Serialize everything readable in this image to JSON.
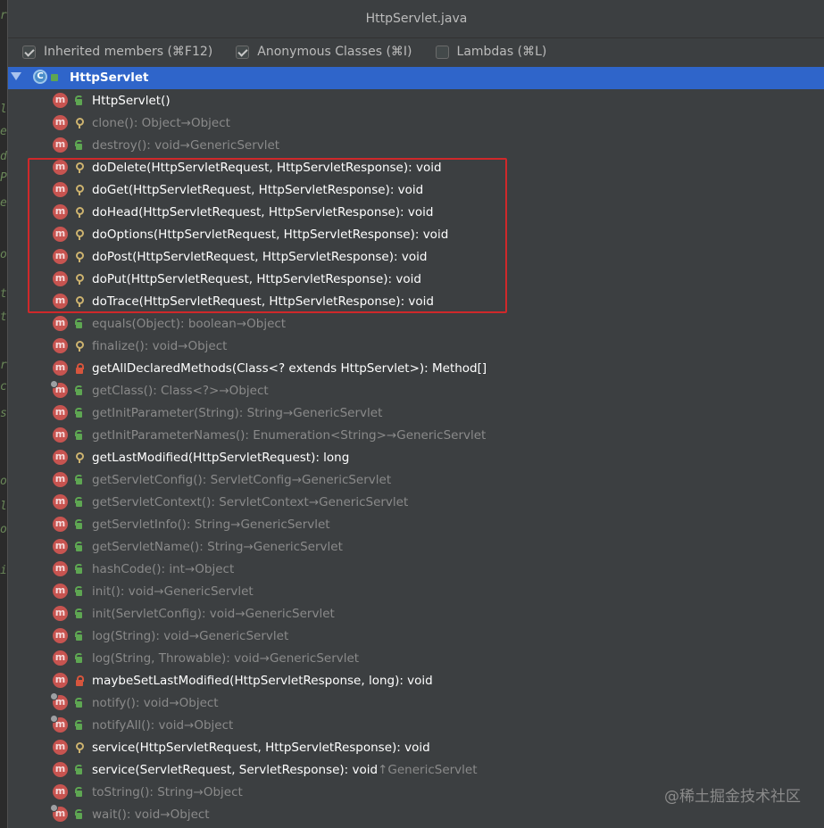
{
  "window": {
    "title": "HttpServlet.java"
  },
  "options": [
    {
      "label": "Inherited members (⌘F12)",
      "checked": true
    },
    {
      "label": "Anonymous Classes (⌘I)",
      "checked": true
    },
    {
      "label": "Lambdas (⌘L)",
      "checked": false
    }
  ],
  "root": {
    "label": "HttpServlet"
  },
  "members": [
    {
      "sig": "HttpServlet()",
      "suffix": "",
      "vis": "public",
      "inherited": false
    },
    {
      "sig": "clone(): Object",
      "suffix": " →Object",
      "vis": "protected",
      "inherited": true
    },
    {
      "sig": "destroy(): void",
      "suffix": " →GenericServlet",
      "vis": "public",
      "inherited": true
    },
    {
      "sig": "doDelete(HttpServletRequest, HttpServletResponse): void",
      "suffix": "",
      "vis": "protected",
      "inherited": false
    },
    {
      "sig": "doGet(HttpServletRequest, HttpServletResponse): void",
      "suffix": "",
      "vis": "protected",
      "inherited": false
    },
    {
      "sig": "doHead(HttpServletRequest, HttpServletResponse): void",
      "suffix": "",
      "vis": "protected",
      "inherited": false
    },
    {
      "sig": "doOptions(HttpServletRequest, HttpServletResponse): void",
      "suffix": "",
      "vis": "protected",
      "inherited": false
    },
    {
      "sig": "doPost(HttpServletRequest, HttpServletResponse): void",
      "suffix": "",
      "vis": "protected",
      "inherited": false
    },
    {
      "sig": "doPut(HttpServletRequest, HttpServletResponse): void",
      "suffix": "",
      "vis": "protected",
      "inherited": false
    },
    {
      "sig": "doTrace(HttpServletRequest, HttpServletResponse): void",
      "suffix": "",
      "vis": "protected",
      "inherited": false
    },
    {
      "sig": "equals(Object): boolean",
      "suffix": " →Object",
      "vis": "public",
      "inherited": true
    },
    {
      "sig": "finalize(): void",
      "suffix": " →Object",
      "vis": "protected",
      "inherited": true
    },
    {
      "sig": "getAllDeclaredMethods(Class<? extends HttpServlet>): Method[]",
      "suffix": "",
      "vis": "private",
      "inherited": false
    },
    {
      "sig": "getClass(): Class<?>",
      "suffix": " →Object",
      "vis": "public",
      "inherited": true,
      "override": true
    },
    {
      "sig": "getInitParameter(String): String",
      "suffix": " →GenericServlet",
      "vis": "public",
      "inherited": true
    },
    {
      "sig": "getInitParameterNames(): Enumeration<String>",
      "suffix": " →GenericServlet",
      "vis": "public",
      "inherited": true
    },
    {
      "sig": "getLastModified(HttpServletRequest): long",
      "suffix": "",
      "vis": "protected",
      "inherited": false
    },
    {
      "sig": "getServletConfig(): ServletConfig",
      "suffix": " →GenericServlet",
      "vis": "public",
      "inherited": true
    },
    {
      "sig": "getServletContext(): ServletContext",
      "suffix": " →GenericServlet",
      "vis": "public",
      "inherited": true
    },
    {
      "sig": "getServletInfo(): String",
      "suffix": " →GenericServlet",
      "vis": "public",
      "inherited": true
    },
    {
      "sig": "getServletName(): String",
      "suffix": " →GenericServlet",
      "vis": "public",
      "inherited": true
    },
    {
      "sig": "hashCode(): int",
      "suffix": " →Object",
      "vis": "public",
      "inherited": true
    },
    {
      "sig": "init(): void",
      "suffix": " →GenericServlet",
      "vis": "public",
      "inherited": true
    },
    {
      "sig": "init(ServletConfig): void",
      "suffix": " →GenericServlet",
      "vis": "public",
      "inherited": true
    },
    {
      "sig": "log(String): void",
      "suffix": " →GenericServlet",
      "vis": "public",
      "inherited": true
    },
    {
      "sig": "log(String, Throwable): void",
      "suffix": " →GenericServlet",
      "vis": "public",
      "inherited": true
    },
    {
      "sig": "maybeSetLastModified(HttpServletResponse, long): void",
      "suffix": "",
      "vis": "private",
      "inherited": false
    },
    {
      "sig": "notify(): void",
      "suffix": " →Object",
      "vis": "public",
      "inherited": true,
      "override": true
    },
    {
      "sig": "notifyAll(): void",
      "suffix": " →Object",
      "vis": "public",
      "inherited": true,
      "override": true
    },
    {
      "sig": "service(HttpServletRequest, HttpServletResponse): void",
      "suffix": "",
      "vis": "protected",
      "inherited": false
    },
    {
      "sig": "service(ServletRequest, ServletResponse): void",
      "suffix": " ↑GenericServlet",
      "vis": "public",
      "inherited": false
    },
    {
      "sig": "toString(): String",
      "suffix": " →Object",
      "vis": "public",
      "inherited": true
    },
    {
      "sig": "wait(): void",
      "suffix": " →Object",
      "vis": "public",
      "inherited": true,
      "override": true
    }
  ],
  "watermark": "@稀土掘金技术社区",
  "left_margin_chars": [
    "r",
    "l",
    "e",
    "d",
    "P",
    "e",
    "o",
    "t",
    "t",
    "r",
    "c",
    "s",
    "o",
    "l",
    "o",
    "i"
  ]
}
